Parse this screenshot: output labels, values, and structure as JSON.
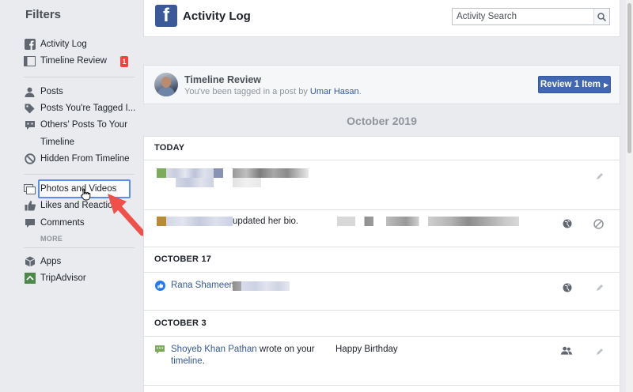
{
  "sidebar": {
    "title": "Filters",
    "items": [
      {
        "label": "Activity Log",
        "icon": "facebook-icon"
      },
      {
        "label": "Timeline Review",
        "icon": "timeline-review-icon",
        "badge": "1"
      },
      {
        "label": "Posts",
        "icon": "person-icon"
      },
      {
        "label": "Posts You're Tagged I...",
        "icon": "tag-icon"
      },
      {
        "label": "Others' Posts To Your",
        "label2": "Timeline",
        "icon": "speech-bubble-icon"
      },
      {
        "label": "Hidden From Timeline",
        "icon": "hidden-icon"
      },
      {
        "label": "Photos and Videos",
        "icon": "photos-icon"
      },
      {
        "label": "Likes and Reactions",
        "icon": "thumbs-up-icon"
      },
      {
        "label": "Comments",
        "icon": "comment-icon"
      },
      {
        "label": "Apps",
        "icon": "cube-icon"
      },
      {
        "label": "TripAdvisor",
        "icon": "tripadvisor-icon"
      }
    ],
    "more": "MORE"
  },
  "header": {
    "title": "Activity Log",
    "search_placeholder": "Activity Search"
  },
  "review": {
    "title": "Timeline Review",
    "subtitle_prefix": "You've been tagged in a post by ",
    "subtitle_link": "Umar Hasan",
    "subtitle_suffix": ".",
    "button": "Review 1 Item"
  },
  "month": "October 2019",
  "feed": {
    "sections": [
      {
        "heading": "TODAY"
      },
      {
        "heading": "OCTOBER 17"
      },
      {
        "heading": "OCTOBER 3"
      }
    ],
    "row2_text": "updated her bio.",
    "row3_name": "Rana Shameem",
    "row4_name": "Shoyeb Khan Pathan",
    "row4_text1": " wrote on your",
    "row4_link2": "timeline",
    "row4_text2": ".",
    "row4_message": "Happy Birthday"
  },
  "colors": {
    "brand": "#3b5998",
    "link": "#365899",
    "button": "#4267b2",
    "badge": "#fa3e3e",
    "highlight": "#5b8cf2",
    "arrow": "#f0504a"
  }
}
